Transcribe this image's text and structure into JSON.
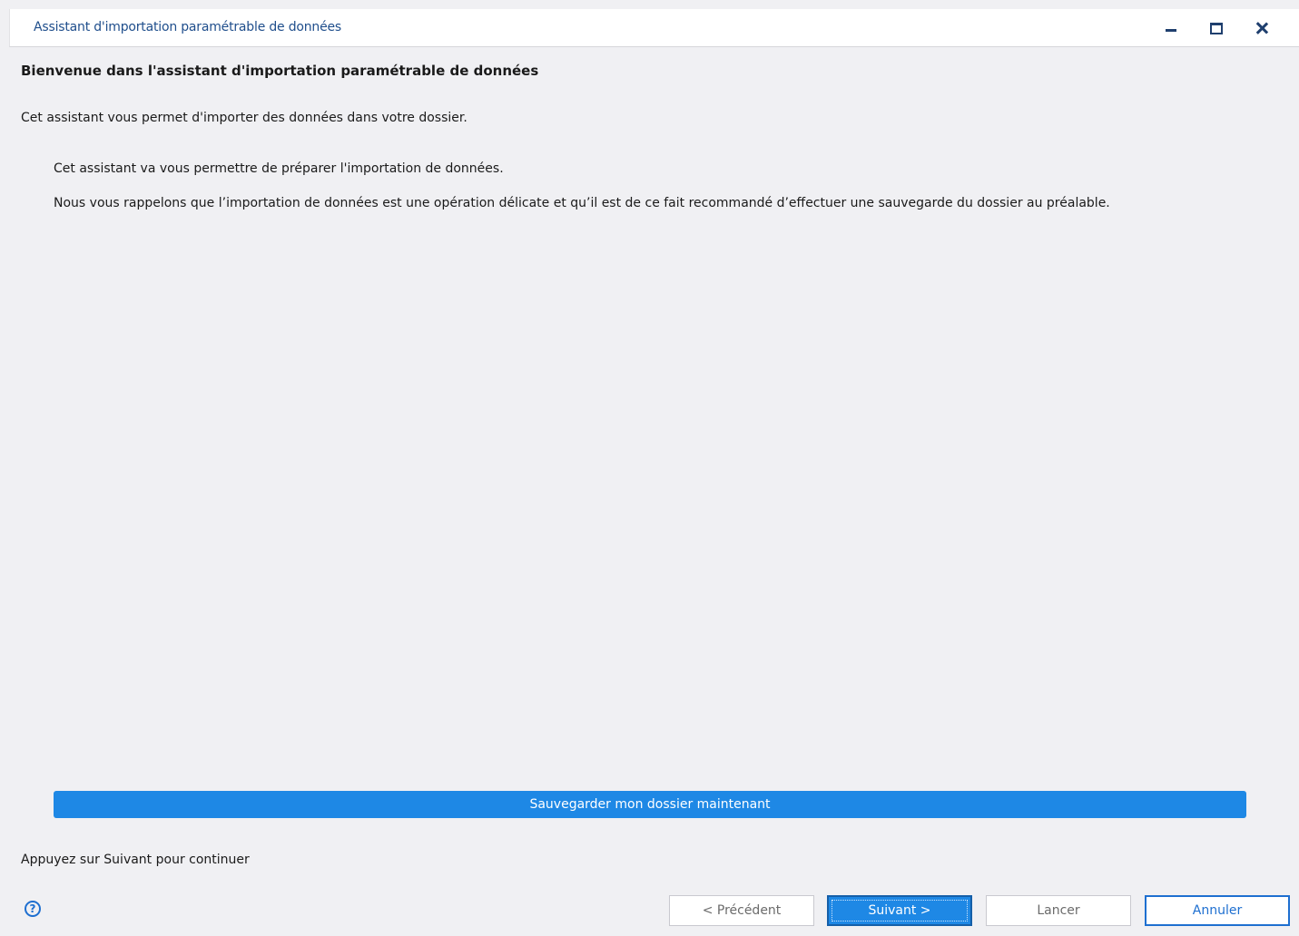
{
  "window": {
    "title": "Assistant d'importation paramétrable de données"
  },
  "content": {
    "heading": "Bienvenue dans l'assistant d'importation paramétrable de données",
    "intro": "Cet assistant vous permet d'importer des données dans votre dossier.",
    "paragraph1": "Cet assistant va vous permettre de préparer l'importation de données.",
    "paragraph2": "Nous vous rappelons que l’importation de données est une opération délicate et qu’il est de ce fait recommandé d’effectuer une sauvegarde du dossier au préalable.",
    "backup_button": "Sauvegarder mon dossier maintenant",
    "hint": "Appuyez sur Suivant pour continuer"
  },
  "footer": {
    "help_icon": "?",
    "prev_label": "< Précédent",
    "next_label": "Suivant >",
    "launch_label": "Lancer",
    "cancel_label": "Annuler"
  },
  "colors": {
    "accent": "#1e88e5",
    "title_text": "#1f4e8c",
    "background": "#f0f0f3"
  }
}
